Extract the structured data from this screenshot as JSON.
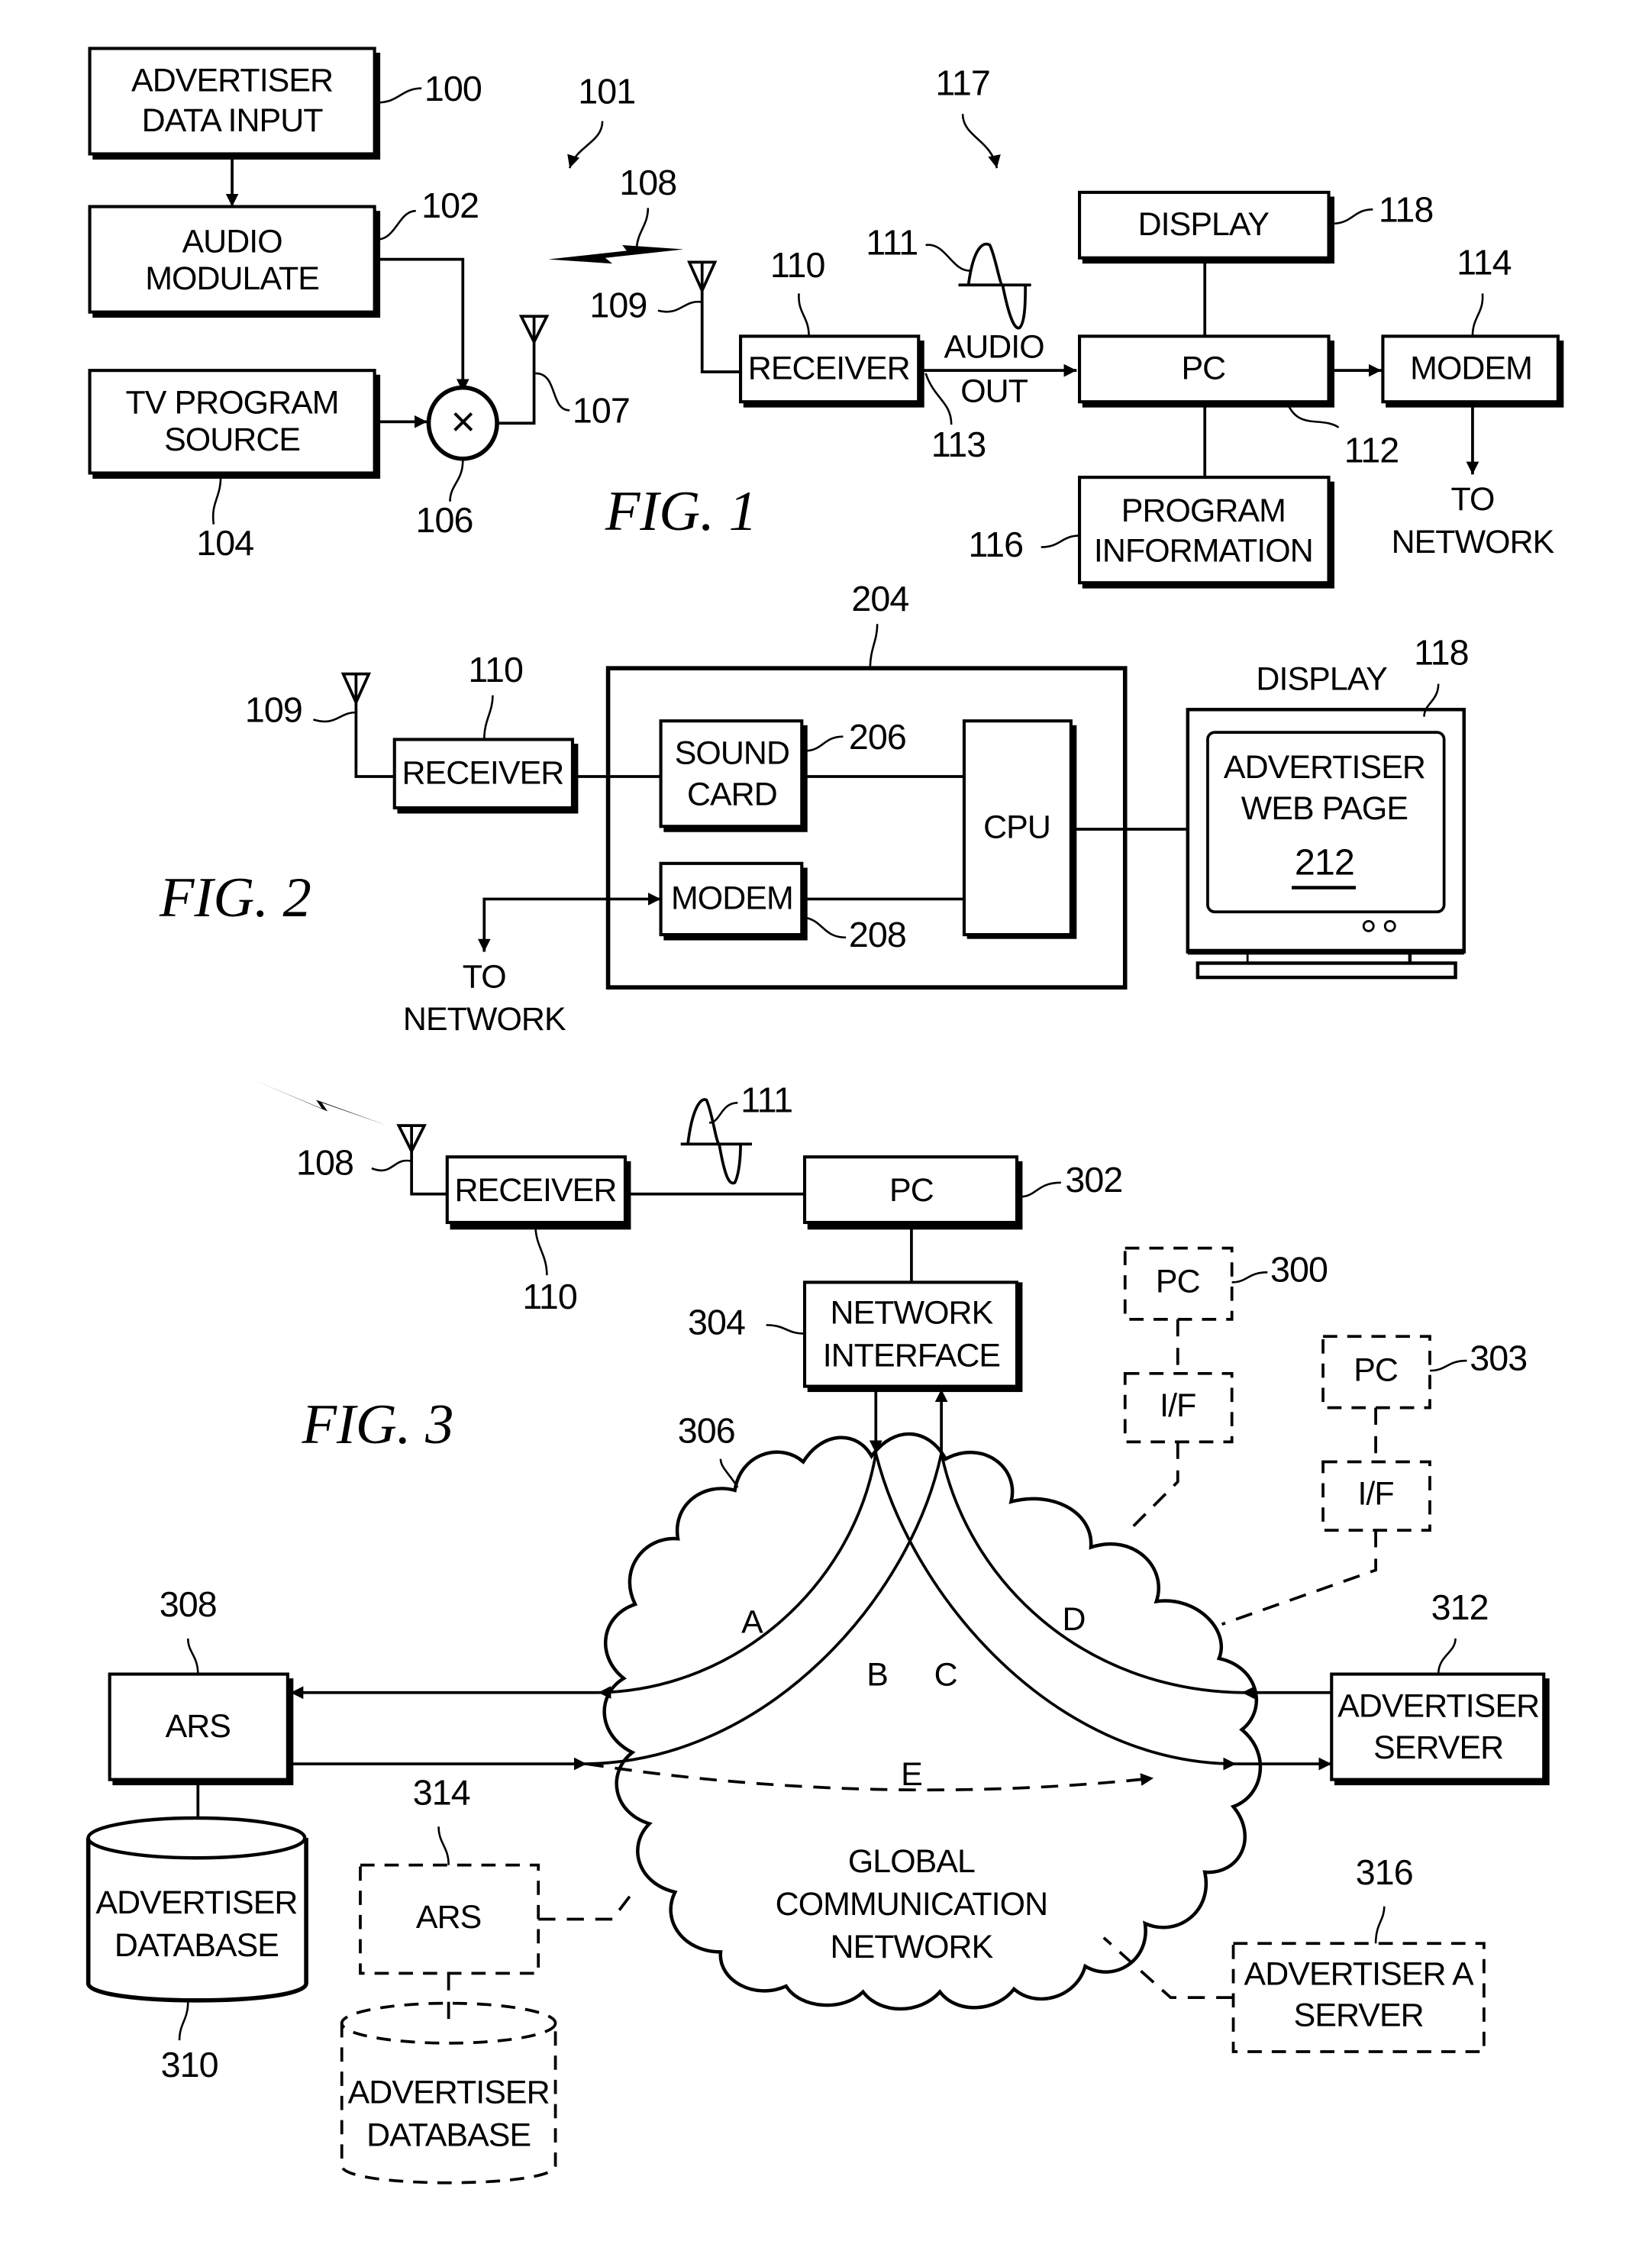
{
  "fig1": {
    "caption": "FIG. 1",
    "blocks": {
      "advertiser_data_input": [
        "ADVERTISER",
        "DATA INPUT"
      ],
      "audio_modulate": [
        "AUDIO",
        "MODULATE"
      ],
      "tv_program_source": [
        "TV PROGRAM",
        "SOURCE"
      ],
      "mixer_symbol": "×",
      "receiver": "RECEIVER",
      "audio_out": [
        "AUDIO",
        "OUT"
      ],
      "display": "DISPLAY",
      "pc": "PC",
      "modem": "MODEM",
      "program_information": [
        "PROGRAM",
        "INFORMATION"
      ],
      "to_network": [
        "TO",
        "NETWORK"
      ]
    },
    "refs": {
      "r100": "100",
      "r101": "101",
      "r102": "102",
      "r104": "104",
      "r106": "106",
      "r107": "107",
      "r108": "108",
      "r109": "109",
      "r110": "110",
      "r111": "111",
      "r112": "112",
      "r113": "113",
      "r114": "114",
      "r116": "116",
      "r117": "117",
      "r118": "118"
    }
  },
  "fig2": {
    "caption": "FIG. 2",
    "blocks": {
      "receiver": "RECEIVER",
      "sound_card": [
        "SOUND",
        "CARD"
      ],
      "modem": "MODEM",
      "cpu": "CPU",
      "display_label": "DISPLAY",
      "screen": [
        "ADVERTISER",
        "WEB PAGE"
      ],
      "screen_ref": "212",
      "to_network": [
        "TO",
        "NETWORK"
      ]
    },
    "refs": {
      "r109": "109",
      "r110": "110",
      "r204": "204",
      "r206": "206",
      "r208": "208",
      "r118": "118"
    }
  },
  "fig3": {
    "caption": "FIG. 3",
    "blocks": {
      "receiver": "RECEIVER",
      "pc": "PC",
      "network_interface": [
        "NETWORK",
        "INTERFACE"
      ],
      "pc_300": "PC",
      "if_300": "I/F",
      "pc_303": "PC",
      "if_303": "I/F",
      "ars": "ARS",
      "advertiser_database": [
        "ADVERTISER",
        "DATABASE"
      ],
      "ars_alt": "ARS",
      "advertiser_database_alt": [
        "ADVERTISER",
        "DATABASE"
      ],
      "advertiser_server": [
        "ADVERTISER",
        "SERVER"
      ],
      "advertiser_a_server": [
        "ADVERTISER A",
        "SERVER"
      ],
      "network": [
        "GLOBAL",
        "COMMUNICATION",
        "NETWORK"
      ]
    },
    "paths": {
      "a": "A",
      "b": "B",
      "c": "C",
      "d": "D",
      "e": "E"
    },
    "refs": {
      "r108": "108",
      "r110": "110",
      "r111": "111",
      "r300": "300",
      "r302": "302",
      "r303": "303",
      "r304": "304",
      "r306": "306",
      "r308": "308",
      "r310": "310",
      "r312": "312",
      "r314": "314",
      "r316": "316"
    }
  }
}
